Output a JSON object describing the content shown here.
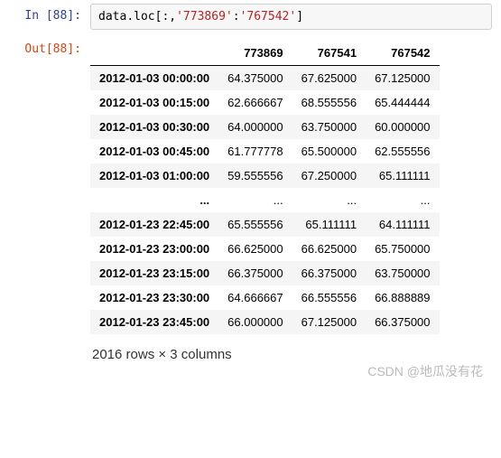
{
  "input": {
    "prompt": "In  [88]:",
    "code_tokens": [
      "data",
      ".",
      "loc",
      "[",
      ":",
      ",",
      "'773869'",
      ":",
      "'767542'",
      "]"
    ]
  },
  "output": {
    "prompt": "Out[88]:",
    "columns": [
      "773869",
      "767541",
      "767542"
    ],
    "rows_top": [
      {
        "idx": "2012-01-03 00:00:00",
        "v": [
          "64.375000",
          "67.625000",
          "67.125000"
        ]
      },
      {
        "idx": "2012-01-03 00:15:00",
        "v": [
          "62.666667",
          "68.555556",
          "65.444444"
        ]
      },
      {
        "idx": "2012-01-03 00:30:00",
        "v": [
          "64.000000",
          "63.750000",
          "60.000000"
        ]
      },
      {
        "idx": "2012-01-03 00:45:00",
        "v": [
          "61.777778",
          "65.500000",
          "62.555556"
        ]
      },
      {
        "idx": "2012-01-03 01:00:00",
        "v": [
          "59.555556",
          "67.250000",
          "65.111111"
        ]
      }
    ],
    "ellipsis": "...",
    "rows_bottom": [
      {
        "idx": "2012-01-23 22:45:00",
        "v": [
          "65.555556",
          "65.111111",
          "64.111111"
        ]
      },
      {
        "idx": "2012-01-23 23:00:00",
        "v": [
          "66.625000",
          "66.625000",
          "65.750000"
        ]
      },
      {
        "idx": "2012-01-23 23:15:00",
        "v": [
          "66.375000",
          "66.375000",
          "63.750000"
        ]
      },
      {
        "idx": "2012-01-23 23:30:00",
        "v": [
          "64.666667",
          "66.555556",
          "66.888889"
        ]
      },
      {
        "idx": "2012-01-23 23:45:00",
        "v": [
          "66.000000",
          "67.125000",
          "66.375000"
        ]
      }
    ],
    "shape": "2016 rows × 3 columns"
  },
  "watermark": "CSDN @地瓜没有花"
}
